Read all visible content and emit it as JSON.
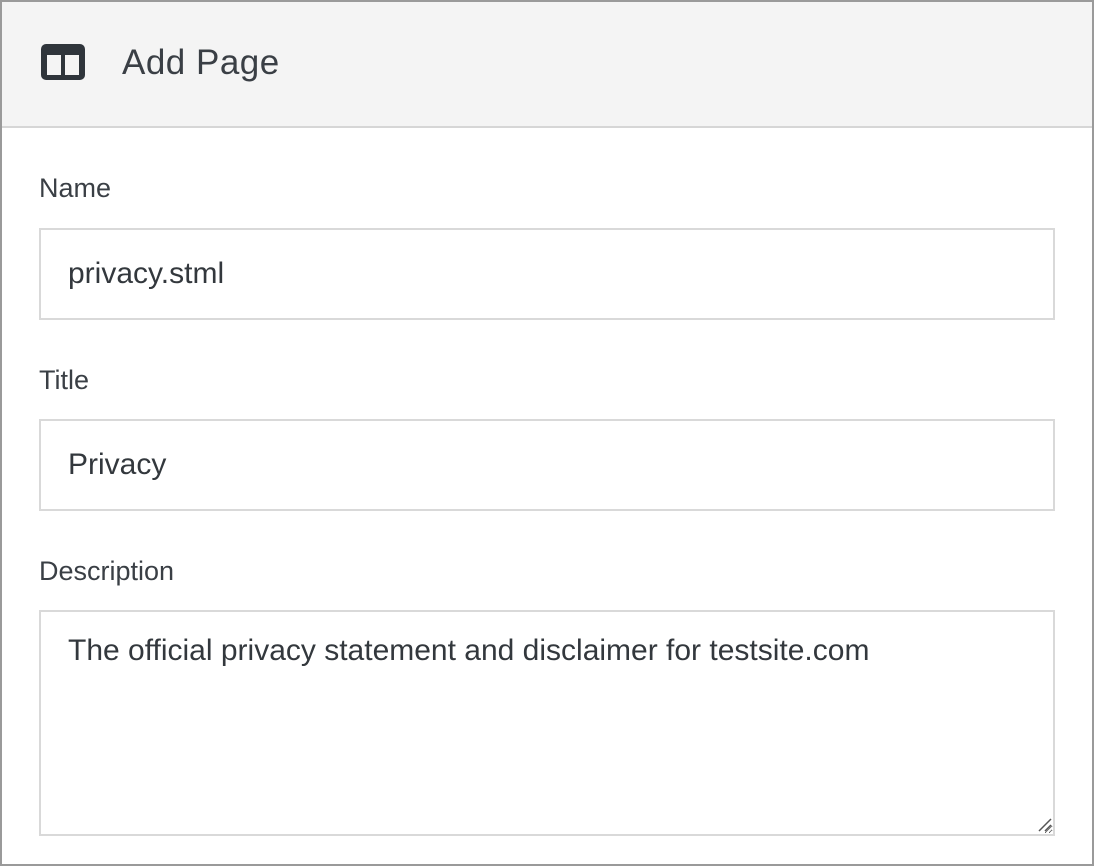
{
  "header": {
    "title": "Add Page",
    "icon": "columns-icon"
  },
  "form": {
    "name": {
      "label": "Name",
      "value": "privacy.stml"
    },
    "title": {
      "label": "Title",
      "value": "Privacy"
    },
    "description": {
      "label": "Description",
      "value": "The official privacy statement and disclaimer for testsite.com"
    }
  },
  "colors": {
    "header_background": "#f4f4f4",
    "icon": "#2f353b",
    "border": "#d9d9d9"
  }
}
